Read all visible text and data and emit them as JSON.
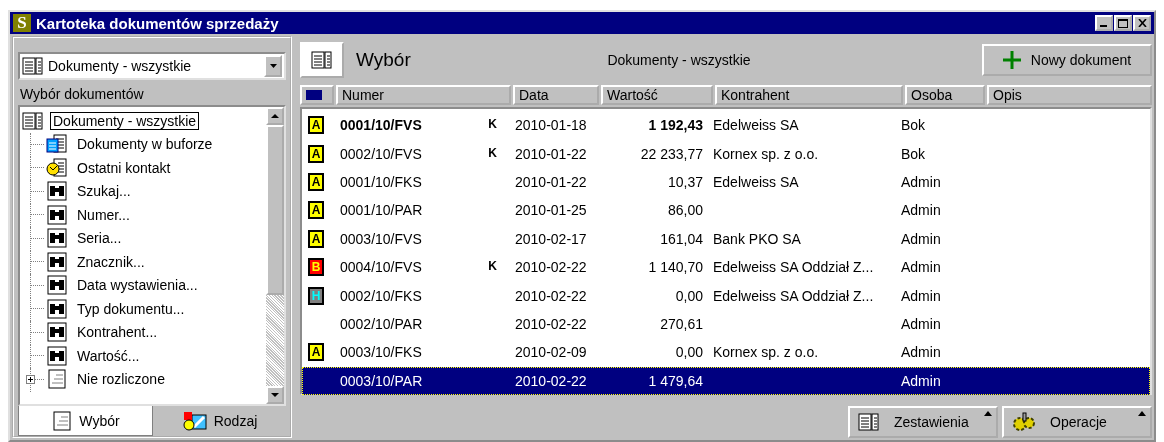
{
  "window": {
    "title": "Kartoteka dokumentów sprzedaży",
    "app_letter": "S"
  },
  "left": {
    "combo": {
      "value": "Dokumenty - wszystkie"
    },
    "label": "Wybór dokumentów",
    "tree": [
      {
        "label": "Dokumenty - wszystkie",
        "kind": "list",
        "selected": true,
        "children": [
          {
            "label": "Dokumenty w buforze",
            "kind": "buffer",
            "selected": false
          },
          {
            "label": "Ostatni kontakt",
            "kind": "contact",
            "selected": false
          },
          {
            "label": "Szukaj...",
            "kind": "search",
            "selected": false
          },
          {
            "label": "Numer...",
            "kind": "search",
            "selected": false
          },
          {
            "label": "Seria...",
            "kind": "search",
            "selected": false
          },
          {
            "label": "Znacznik...",
            "kind": "search",
            "selected": false
          },
          {
            "label": "Data wystawienia...",
            "kind": "search",
            "selected": false
          },
          {
            "label": "Typ dokumentu...",
            "kind": "search",
            "selected": false
          },
          {
            "label": "Kontrahent...",
            "kind": "search",
            "selected": false
          },
          {
            "label": "Wartość...",
            "kind": "search",
            "selected": false
          },
          {
            "label": "Nie rozliczone",
            "kind": "page",
            "selected": false,
            "expanded": false
          }
        ]
      }
    ],
    "tabs": [
      {
        "label": "Wybór",
        "kind": "page",
        "selected": true
      },
      {
        "label": "Rodzaj",
        "kind": "shapes",
        "selected": false
      }
    ]
  },
  "toolbar": {
    "title": "Wybór",
    "filter": "Dokumenty - wszystkie",
    "new_button": "Nowy dokument"
  },
  "table": {
    "columns": [
      "Numer",
      "Data",
      "Wartość",
      "Kontrahent",
      "Osoba",
      "Opis"
    ],
    "rows": [
      {
        "badge": {
          "letter": "A",
          "color": "#ffff00"
        },
        "number": "0001/10/FVS",
        "flag": "K",
        "date": "2010-01-18",
        "value": "1 192,43",
        "contractor": "Edelweiss SA",
        "person": "Bok",
        "bold": true,
        "selected": false
      },
      {
        "badge": {
          "letter": "A",
          "color": "#ffff00"
        },
        "number": "0002/10/FVS",
        "flag": "K",
        "date": "2010-01-22",
        "value": "22 233,77",
        "contractor": "Kornex sp. z o.o.",
        "person": "Bok",
        "bold": false,
        "selected": false
      },
      {
        "badge": {
          "letter": "A",
          "color": "#ffff00"
        },
        "number": "0001/10/FKS",
        "date": "2010-01-22",
        "value": "10,37",
        "contractor": "Edelweiss SA",
        "person": "Admin",
        "bold": false,
        "selected": false
      },
      {
        "badge": {
          "letter": "A",
          "color": "#ffff00"
        },
        "number": "0001/10/PAR",
        "date": "2010-01-25",
        "value": "86,00",
        "person": "Admin",
        "bold": false,
        "selected": false
      },
      {
        "badge": {
          "letter": "A",
          "color": "#ffff00"
        },
        "number": "0003/10/FVS",
        "date": "2010-02-17",
        "value": "161,04",
        "contractor": "Bank PKO SA",
        "person": "Admin",
        "bold": false,
        "selected": false
      },
      {
        "badge": {
          "letter": "B",
          "color": "#ff0000"
        },
        "number": "0004/10/FVS",
        "flag": "K",
        "date": "2010-02-22",
        "value": "1 140,70",
        "contractor": "Edelweiss SA Oddział Z...",
        "person": "Admin",
        "bold": false,
        "selected": false
      },
      {
        "badge": {
          "letter": "H",
          "color": "#808080"
        },
        "number": "0002/10/FKS",
        "date": "2010-02-22",
        "value": "0,00",
        "contractor": "Edelweiss SA Oddział Z...",
        "person": "Admin",
        "bold": false,
        "selected": false
      },
      {
        "number": "0002/10/PAR",
        "date": "2010-02-22",
        "value": "270,61",
        "person": "Admin",
        "bold": false,
        "selected": false
      },
      {
        "badge": {
          "letter": "A",
          "color": "#ffff00"
        },
        "number": "0003/10/FKS",
        "date": "2010-02-09",
        "value": "0,00",
        "contractor": "Kornex sp. z o.o.",
        "person": "Admin",
        "bold": false,
        "selected": false
      },
      {
        "number": "0003/10/PAR",
        "date": "2010-02-22",
        "value": "1 479,64",
        "person": "Admin",
        "bold": false,
        "selected": true
      }
    ]
  },
  "bottom_buttons": [
    {
      "label": "Zestawienia",
      "kind": "list"
    },
    {
      "label": "Operacje",
      "kind": "gears"
    }
  ]
}
